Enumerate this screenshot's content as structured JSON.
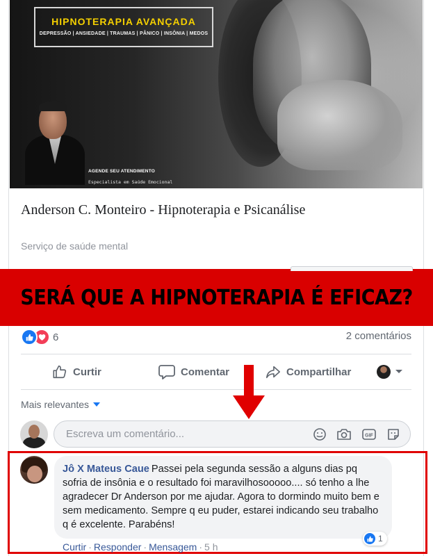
{
  "cover": {
    "title": "HIPNOTERAPIA AVANÇADA",
    "subtitle": "DEPRESSÃO | ANSIEDADE | TRAUMAS | PÂNICO | INSÔNIA | MEDOS",
    "cta": "AGENDE SEU ATENDIMENTO",
    "tagline": "Especialista em Saúde Emocional"
  },
  "page": {
    "name": "Anderson C. Monteiro - Hipnoterapia e Psicanálise",
    "category": "Serviço de saúde mental"
  },
  "banner": {
    "text": "SERÁ QUE A HIPNOTERAPIA É EFICAZ?",
    "color": "#d90000"
  },
  "post": {
    "reaction_count": "6",
    "comments_count": "2 comentários",
    "actions": {
      "like": "Curtir",
      "comment": "Comentar",
      "share": "Compartilhar"
    }
  },
  "comments_section": {
    "sort_label": "Mais relevantes",
    "input_placeholder": "Escreva um comentário...",
    "comment": {
      "author": "Jô X Mateus Caue",
      "text": "Passei pela segunda sessão a alguns dias pq sofria de insônia e o resultado foi maravilhosooooo.... só tenho a lhe agradecer Dr Anderson por me ajudar. Agora to dormindo muito bem e sem medicamento. Sempre q eu puder, estarei indicando seu trabalho q é excelente. Parabéns!",
      "reaction_count": "1",
      "meta": {
        "like": "Curtir",
        "reply": "Responder",
        "message": "Mensagem",
        "time": "5 h"
      }
    }
  },
  "icons": [
    "like-icon",
    "love-icon",
    "comment-icon",
    "share-icon",
    "emoji-icon",
    "camera-icon",
    "gif-icon",
    "sticker-icon",
    "dropdown-arrow-icon"
  ],
  "colors": {
    "facebook_blue": "#1877f2",
    "link_blue": "#385898",
    "highlight_red": "#e00000",
    "cover_title_yellow": "#f5d000"
  }
}
